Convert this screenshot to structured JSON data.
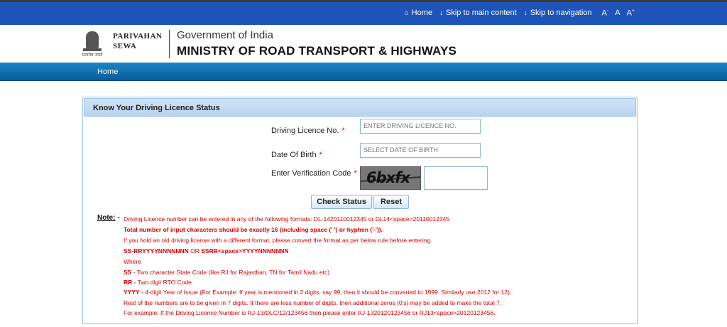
{
  "topbar": {
    "home_label": "Home",
    "skip_main_label": "Skip to main content",
    "skip_nav_label": "Skip to navigation",
    "font_smaller": "A",
    "font_normal": "A",
    "font_larger": "A",
    "font_smaller_sup": "-",
    "font_larger_sup": "+",
    "icons": {
      "home": "home-icon",
      "skip": "arrow-down-icon"
    }
  },
  "header": {
    "emblem_motto": "सत्यमेव जयते",
    "brand_line1": "PARIVAHAN",
    "brand_line2": "SEWA",
    "gov_text": "Government of India",
    "ministry_text": "MINISTRY OF ROAD TRANSPORT & HIGHWAYS"
  },
  "nav": {
    "home_label": "Home"
  },
  "form": {
    "title": "Know Your Driving Licence Status",
    "dl_label": "Driving Licence No.",
    "dl_placeholder": "ENTER DRIVING LICENCE NO.",
    "dob_label": "Date Of Birth",
    "dob_placeholder": "SELECT DATE OF BIRTH",
    "captcha_label": "Enter Verification Code",
    "captcha_text": "6bxfx",
    "required_mark": "*",
    "check_button": "Check Status",
    "reset_button": "Reset"
  },
  "notes": {
    "title": "Note:",
    "dash": "-",
    "line1": "Driving Licence number can be entered in any of the following formats: DL-1420110012345 or DL14<space>20110012345",
    "line2": "Total number of input characters should be exactly 16 (including space (' ') or hyphen ('-')).",
    "line3": "If you hold an old driving license with a different format, please convert the format as per below rule before entering.",
    "line4_a": "SS-RRYYYYNNNNNNN",
    "line4_or": " OR ",
    "line4_b": "SSRR<space>YYYYNNNNNNN",
    "line5": "Where",
    "line6_key": "SS",
    "line6_text": " - Two character State Code (like RJ for Rajasthan, TN for Tamil Nadu etc)",
    "line7_key": "RR",
    "line7_text": " - Two digit RTO Code",
    "line8_key": "YYYY",
    "line8_text": " - 4-digit Year of Issue (For Example: If year is mentioned in 2 digits, say 99, then it should be converted to 1999. Similarly use 2012 for 12).",
    "line9": "Rest of the numbers are to be given in 7 digits. If there are less number of digits, then additional zeros (0's) may be added to make the total 7.",
    "line10": "For example: If the Driving Licence Number is RJ-13/DLC/12/123456 then please enter RJ-1320120123456 or RJ13<space>20120123456."
  },
  "colors": {
    "topbar": "#1e54b7",
    "nav": "#0a6fb3",
    "note_red": "#d40000",
    "panel_border": "#9cc4e4"
  }
}
